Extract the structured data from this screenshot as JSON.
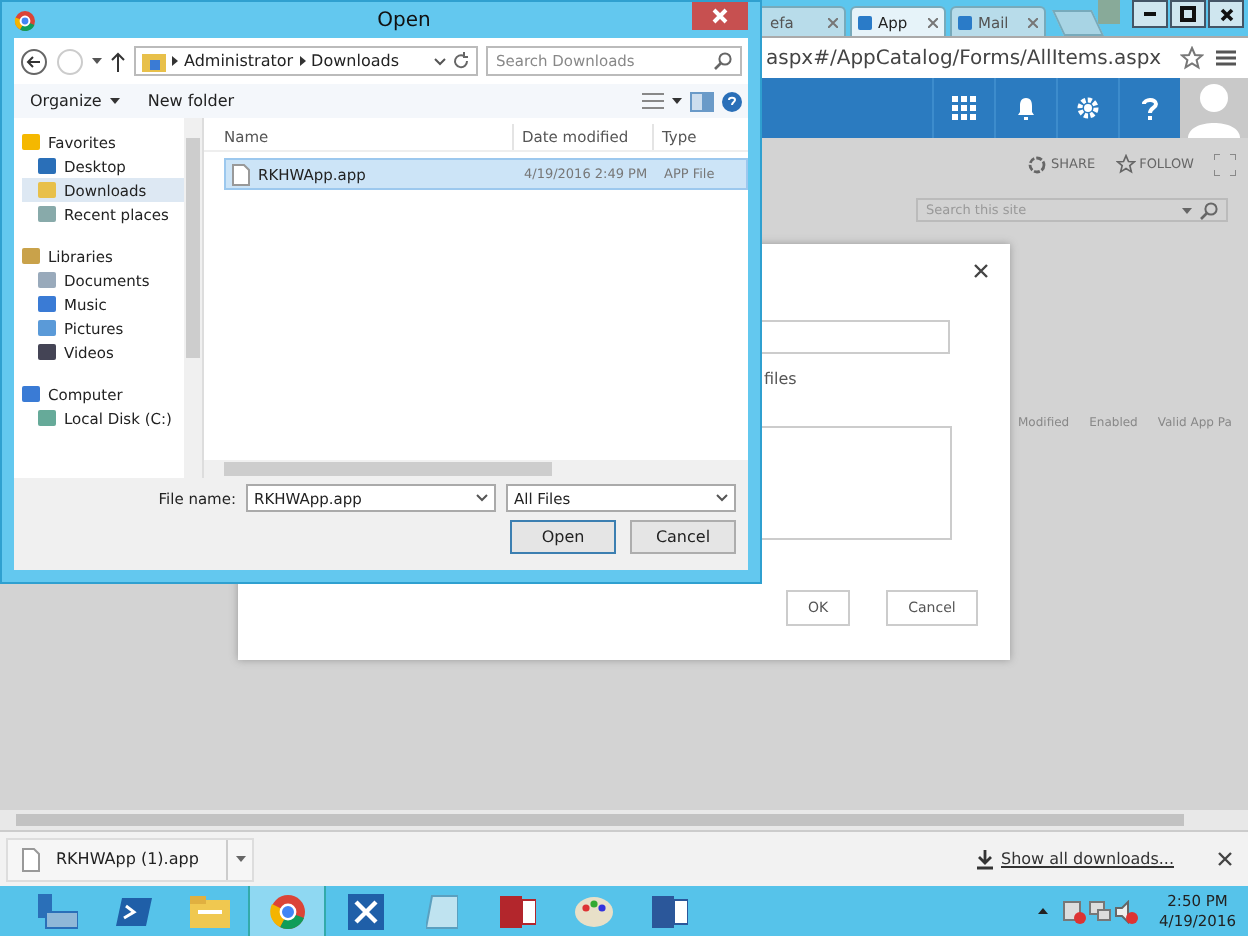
{
  "browser": {
    "tabs": [
      {
        "label": "efa",
        "selected": false
      },
      {
        "label": "App",
        "selected": true
      },
      {
        "label": "Mail",
        "selected": false
      }
    ],
    "address": "aspx#/AppCatalog/Forms/AllItems.aspx"
  },
  "site": {
    "actions": [
      "SHARE",
      "FOLLOW"
    ],
    "search_placeholder": "Search this site",
    "columns": [
      "Modified",
      "Enabled",
      "Valid App Pa"
    ]
  },
  "modal": {
    "text": "files",
    "buttons": [
      "OK",
      "Cancel"
    ]
  },
  "open_dialog": {
    "title": "Open",
    "breadcrumb": [
      "Administrator",
      "Downloads"
    ],
    "search_placeholder": "Search Downloads",
    "toolbar": [
      "Organize",
      "New folder"
    ],
    "nav": [
      {
        "label": "Favorites",
        "kind": "star",
        "children": [
          {
            "label": "Desktop",
            "kind": "desktop",
            "selected": false
          },
          {
            "label": "Downloads",
            "kind": "folder",
            "selected": true
          },
          {
            "label": "Recent places",
            "kind": "recent",
            "selected": false
          }
        ]
      },
      {
        "label": "Libraries",
        "kind": "library",
        "children": [
          {
            "label": "Documents",
            "kind": "document",
            "selected": false
          },
          {
            "label": "Music",
            "kind": "music",
            "selected": false
          },
          {
            "label": "Pictures",
            "kind": "pictures",
            "selected": false
          },
          {
            "label": "Videos",
            "kind": "videos",
            "selected": false
          }
        ]
      },
      {
        "label": "Computer",
        "kind": "computer",
        "children": [
          {
            "label": "Local Disk (C:)",
            "kind": "disk",
            "selected": false
          }
        ]
      }
    ],
    "columns": [
      "Name",
      "Date modified",
      "Type"
    ],
    "files": [
      {
        "name": "RKHWApp.app",
        "date": "4/19/2016 2:49 PM",
        "type": "APP File",
        "selected": true
      }
    ],
    "file_name_label": "File name:",
    "file_name": "RKHWApp.app",
    "filter": "All Files",
    "buttons": [
      "Open",
      "Cancel"
    ]
  },
  "downloads": {
    "file": "RKHWApp (1).app",
    "link": "Show all downloads..."
  },
  "taskbar": {
    "apps": [
      {
        "kind": "server",
        "active": false
      },
      {
        "kind": "powershell",
        "active": false
      },
      {
        "kind": "explorer",
        "active": false
      },
      {
        "kind": "chrome",
        "active": true
      },
      {
        "kind": "tools",
        "active": false
      },
      {
        "kind": "notepad",
        "active": false
      },
      {
        "kind": "access",
        "active": false
      },
      {
        "kind": "paint",
        "active": false
      },
      {
        "kind": "word",
        "active": false
      }
    ],
    "time": "2:50 PM",
    "date": "4/19/2016"
  }
}
